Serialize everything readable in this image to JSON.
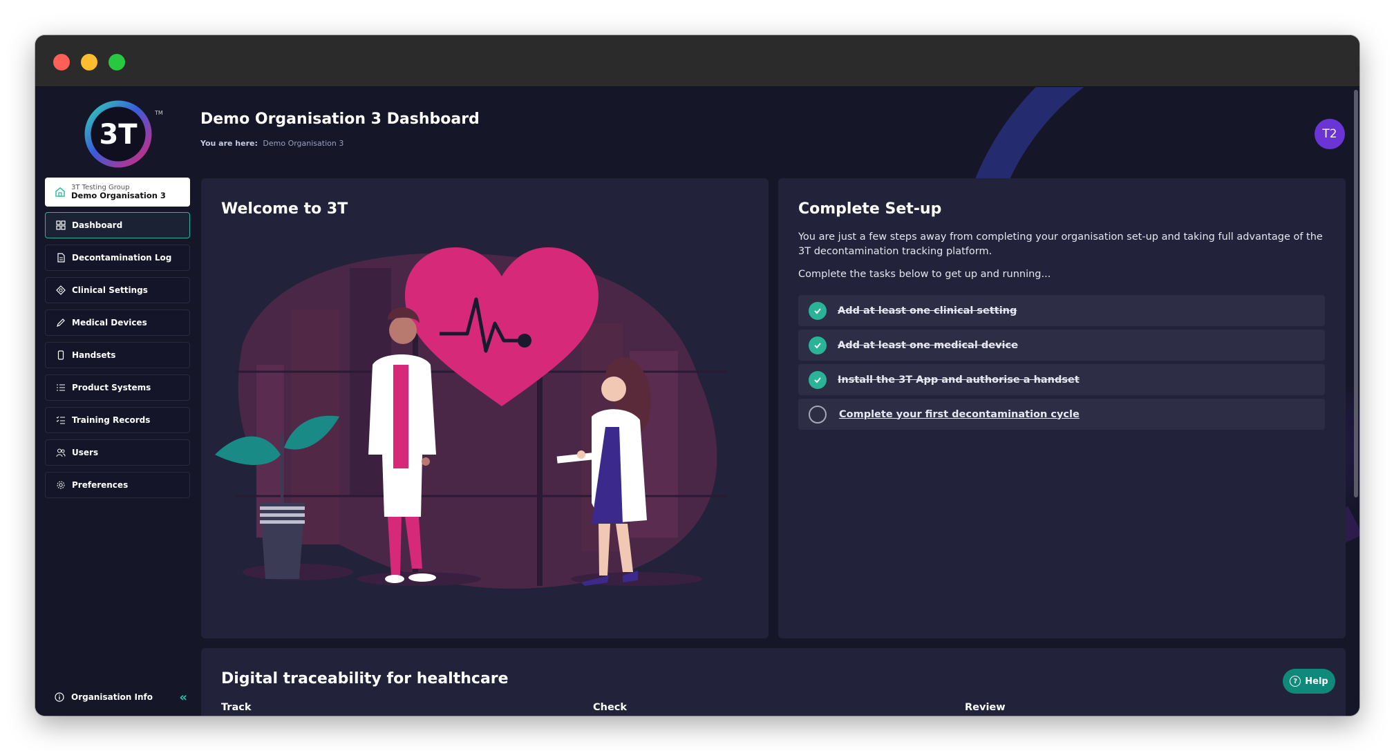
{
  "sidebar": {
    "logo_text": "3T",
    "logo_tm": "TM",
    "org_switch": {
      "group": "3T Testing Group",
      "name": "Demo Organisation 3"
    },
    "items": [
      {
        "label": "Dashboard",
        "icon": "grid-icon",
        "active": true
      },
      {
        "label": "Decontamination Log",
        "icon": "document-icon"
      },
      {
        "label": "Clinical Settings",
        "icon": "diamond-icon"
      },
      {
        "label": "Medical Devices",
        "icon": "pen-icon"
      },
      {
        "label": "Handsets",
        "icon": "phone-icon"
      },
      {
        "label": "Product Systems",
        "icon": "list-icon"
      },
      {
        "label": "Training Records",
        "icon": "checklist-icon"
      },
      {
        "label": "Users",
        "icon": "users-icon"
      },
      {
        "label": "Preferences",
        "icon": "gear-icon"
      }
    ],
    "footer": {
      "label": "Organisation Info",
      "icon": "info-icon",
      "collapse_icon": "chevrons-left-icon"
    }
  },
  "header": {
    "title": "Demo Organisation 3 Dashboard",
    "breadcrumb_label": "You are here:",
    "breadcrumb_value": "Demo Organisation 3",
    "avatar": "T2"
  },
  "welcome": {
    "title": "Welcome to 3T"
  },
  "setup": {
    "title": "Complete Set-up",
    "description": "You are just a few steps away from completing your organisation set-up and taking full advantage of the 3T decontamination tracking platform.",
    "instruction": "Complete the tasks below to get up and running...",
    "tasks": [
      {
        "label": "Add at least one clinical setting",
        "done": true
      },
      {
        "label": "Add at least one medical device",
        "done": true
      },
      {
        "label": "Install the 3T App and authorise a handset",
        "done": true
      },
      {
        "label": "Complete your first decontamination cycle",
        "done": false
      }
    ]
  },
  "bottom": {
    "title": "Digital traceability for healthcare",
    "columns": [
      "Track",
      "Check",
      "Review"
    ],
    "help_label": "Help"
  },
  "colors": {
    "accent": "#2bb39a",
    "avatar": "#6a35d4",
    "heart": "#d6297a",
    "background": "#161629",
    "card": "#22223a"
  }
}
